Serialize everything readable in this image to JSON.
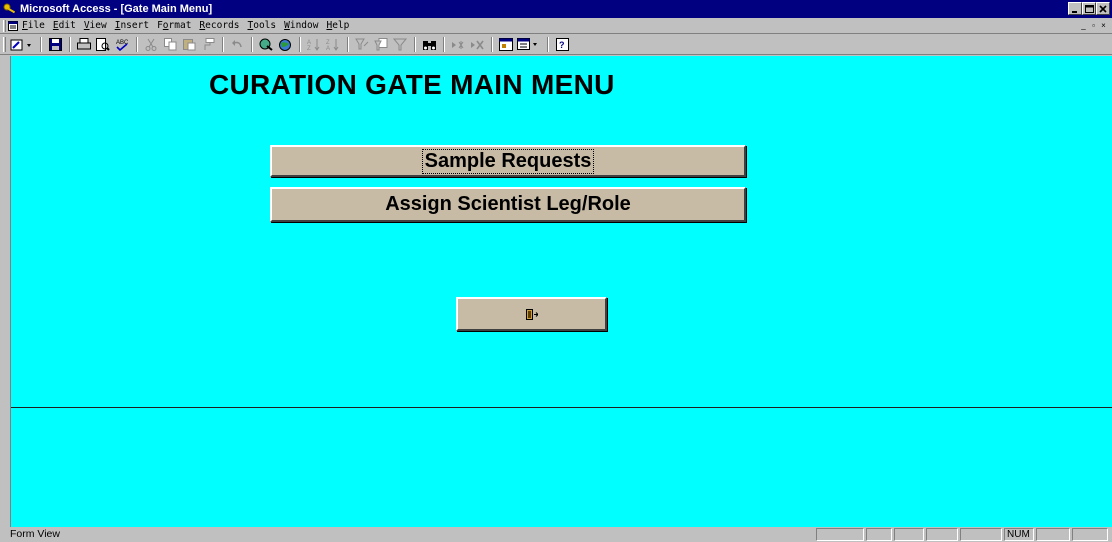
{
  "window": {
    "title": "Microsoft Access - [Gate Main Menu]"
  },
  "menubar": {
    "items": [
      {
        "label": "File",
        "ul": "F",
        "rest": "ile"
      },
      {
        "label": "Edit",
        "ul": "E",
        "rest": "dit"
      },
      {
        "label": "View",
        "ul": "V",
        "rest": "iew"
      },
      {
        "label": "Insert",
        "ul": "I",
        "rest": "nsert"
      },
      {
        "label": "Format",
        "pre": "F",
        "ul": "o",
        "rest": "rmat"
      },
      {
        "label": "Records",
        "ul": "R",
        "rest": "ecords"
      },
      {
        "label": "Tools",
        "ul": "T",
        "rest": "ools"
      },
      {
        "label": "Window",
        "ul": "W",
        "rest": "indow"
      },
      {
        "label": "Help",
        "ul": "H",
        "rest": "elp"
      }
    ]
  },
  "toolbar": {
    "icons": [
      "design-view-icon",
      "save-icon",
      "print-icon",
      "print-preview-icon",
      "spelling-icon",
      "cut-icon",
      "copy-icon",
      "paste-icon",
      "format-painter-icon",
      "undo-icon",
      "insert-hyperlink-icon",
      "web-toolbar-icon",
      "sort-ascending-icon",
      "sort-descending-icon",
      "filter-by-selection-icon",
      "filter-by-form-icon",
      "apply-filter-icon",
      "find-icon",
      "new-record-icon",
      "delete-record-icon",
      "database-window-icon",
      "new-object-icon",
      "help-icon"
    ]
  },
  "form": {
    "title": "CURATION GATE MAIN MENU",
    "buttons": {
      "sample_requests": "Sample Requests",
      "assign_scientist": "Assign Scientist Leg/Role"
    },
    "exit_icon": "exit-door-icon",
    "background": "#00ffff",
    "button_color": "#c8bba6"
  },
  "statusbar": {
    "text": "Form View",
    "num": "NUM"
  },
  "colors": {
    "titlebar": "#000080",
    "chrome": "#c0c0c0"
  }
}
